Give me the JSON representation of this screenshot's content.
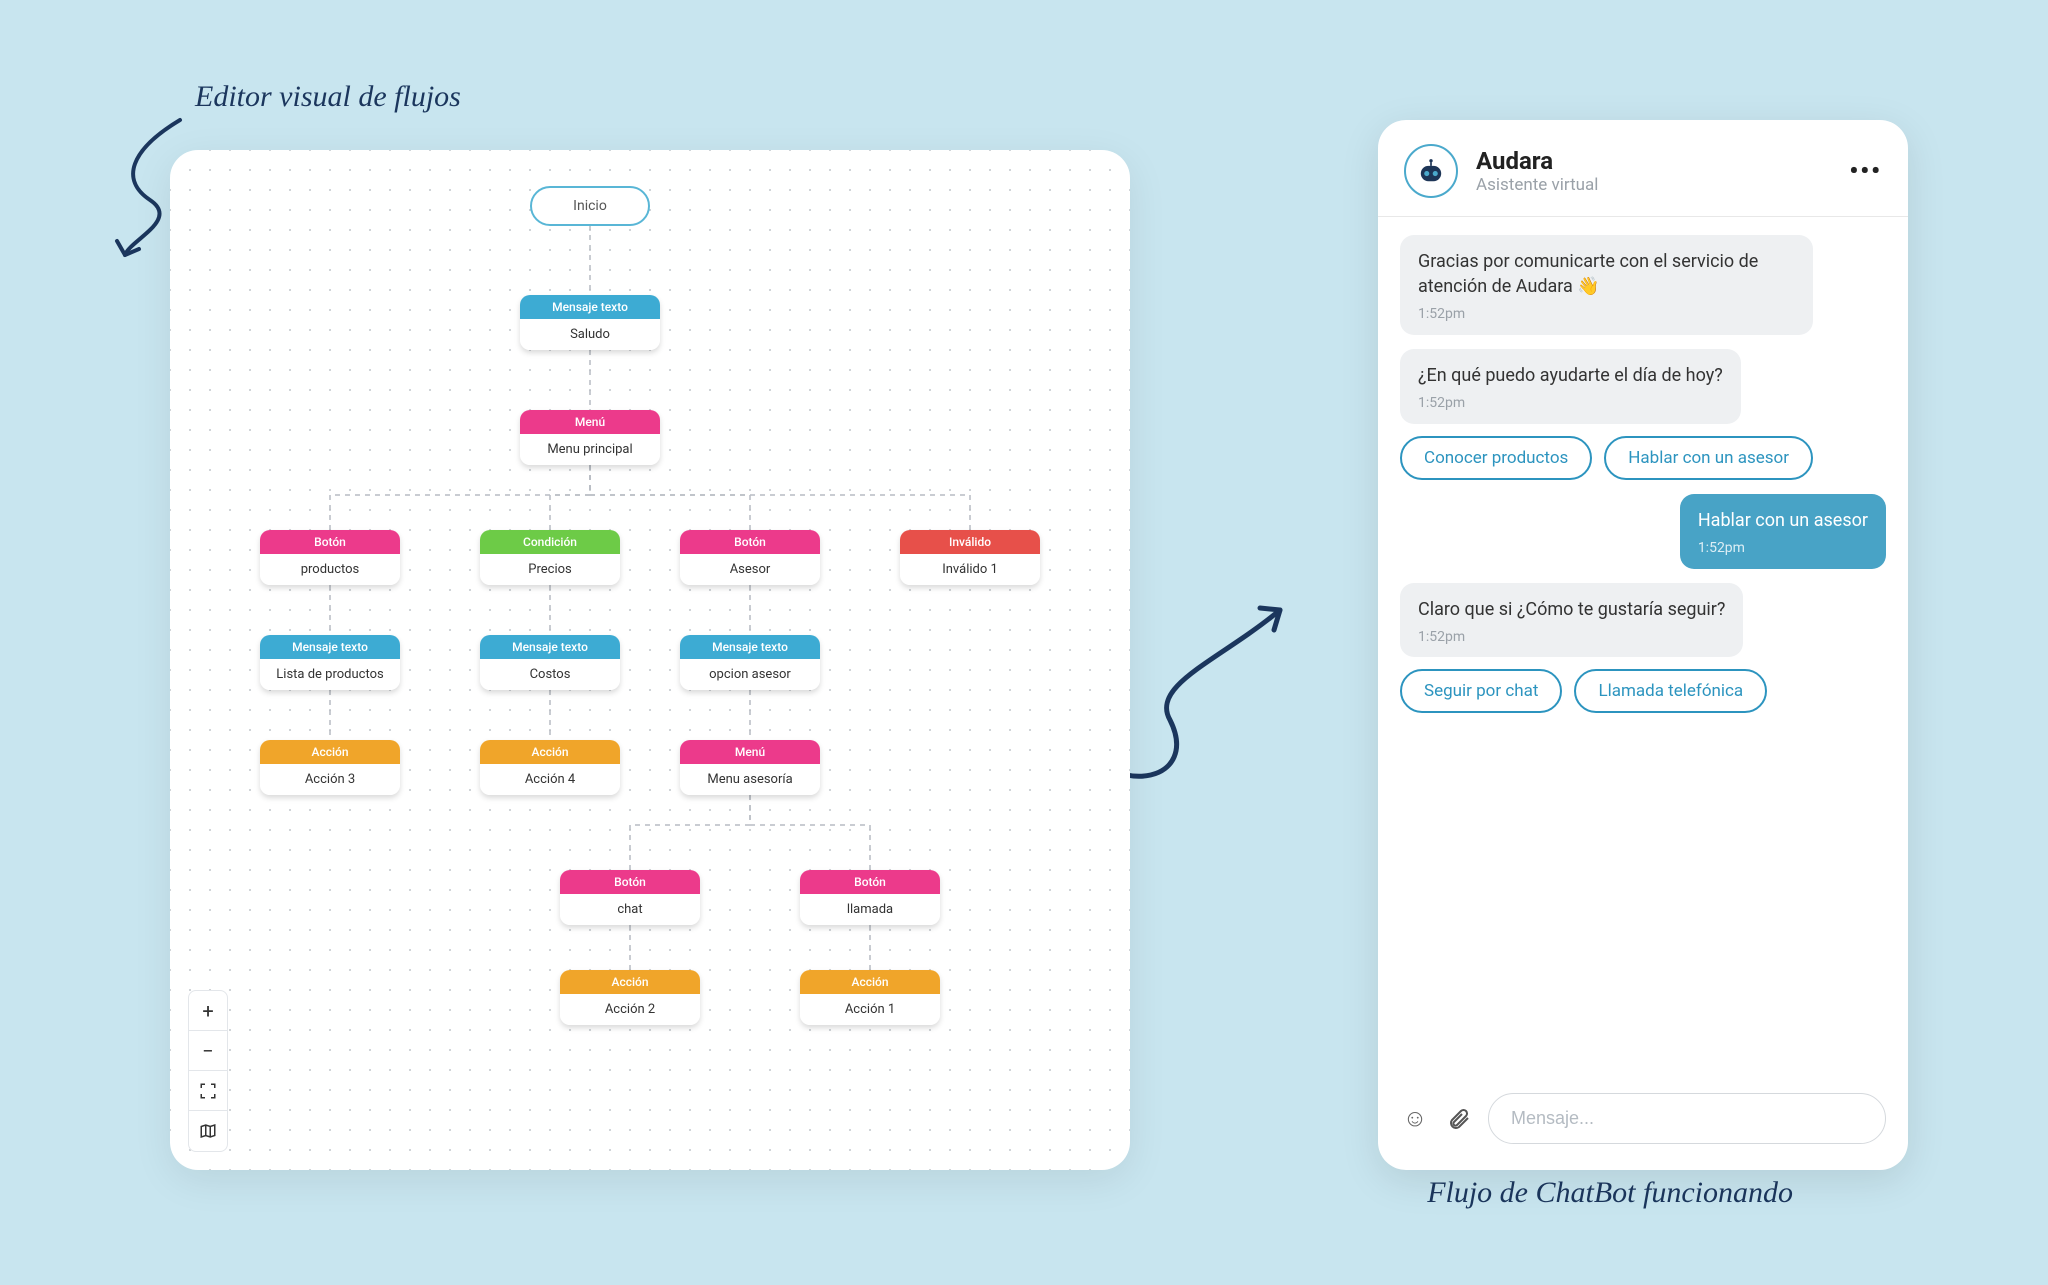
{
  "annotations": {
    "top": "Editor visual de flujos",
    "bottom": "Flujo de ChatBot funcionando"
  },
  "colors": {
    "blue": "#3dabd3",
    "pink": "#ec3a8b",
    "green": "#6dcb47",
    "red": "#e7504a",
    "orange": "#f0a52a",
    "chat_accent": "#48a3c6",
    "chip": "#2c94bf"
  },
  "editor": {
    "zoom_icons": {
      "in": "zoom-in",
      "out": "zoom-out",
      "fit": "fit-view",
      "map": "minimap"
    },
    "nodes": {
      "inicio": {
        "label": "Inicio"
      },
      "saludo": {
        "type": "Mensaje texto",
        "text": "Saludo"
      },
      "menu_principal": {
        "type": "Menú",
        "text": "Menu principal"
      },
      "productos": {
        "type": "Botón",
        "text": "productos"
      },
      "precios": {
        "type": "Condición",
        "text": "Precios"
      },
      "asesor": {
        "type": "Botón",
        "text": "Asesor"
      },
      "invalido": {
        "type": "Inválido",
        "text": "Inválido 1"
      },
      "lista": {
        "type": "Mensaje texto",
        "text": "Lista de productos"
      },
      "costos": {
        "type": "Mensaje texto",
        "text": "Costos"
      },
      "opcion_asesor": {
        "type": "Mensaje texto",
        "text": "opcion asesor"
      },
      "accion3": {
        "type": "Acción",
        "text": "Acción 3"
      },
      "accion4": {
        "type": "Acción",
        "text": "Acción 4"
      },
      "menu_asesor": {
        "type": "Menú",
        "text": "Menu asesoría"
      },
      "chat": {
        "type": "Botón",
        "text": "chat"
      },
      "llamada": {
        "type": "Botón",
        "text": "llamada"
      },
      "accion2": {
        "type": "Acción",
        "text": "Acción 2"
      },
      "accion1": {
        "type": "Acción",
        "text": "Acción 1"
      }
    }
  },
  "chat": {
    "header": {
      "title": "Audara",
      "subtitle": "Asistente virtual"
    },
    "messages": [
      {
        "kind": "bot",
        "text": "Gracias por comunicarte con el servicio de atención de Audara 👋",
        "time": "1:52pm"
      },
      {
        "kind": "bot",
        "text": "¿En qué puedo ayudarte el día de hoy?",
        "time": "1:52pm"
      },
      {
        "kind": "options",
        "items": [
          "Conocer productos",
          "Hablar con un asesor"
        ]
      },
      {
        "kind": "me",
        "text": "Hablar con un asesor",
        "time": "1:52pm"
      },
      {
        "kind": "bot",
        "text": "Claro que si ¿Cómo te gustaría seguir?",
        "time": "1:52pm"
      },
      {
        "kind": "options",
        "items": [
          "Seguir por chat",
          "Llamada telefónica"
        ]
      }
    ],
    "input": {
      "placeholder": "Mensaje..."
    }
  }
}
